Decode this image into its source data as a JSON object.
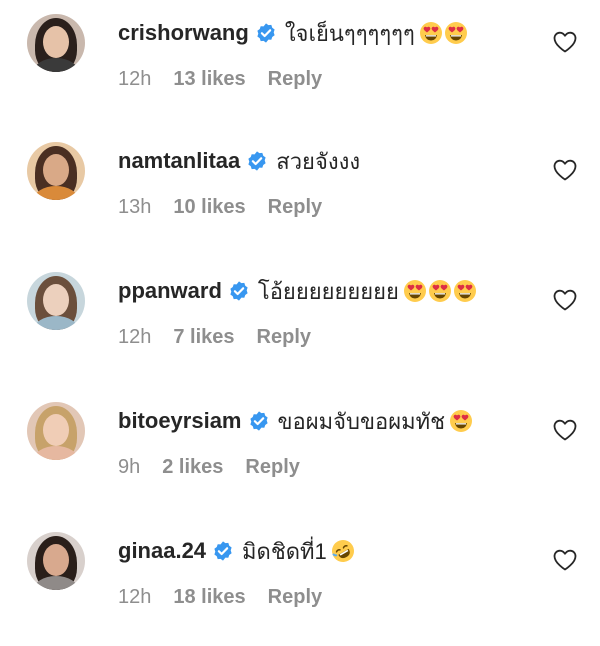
{
  "comments": [
    {
      "username": "crishorwang",
      "verified": true,
      "text": "ใจเย็นๆๆๆๆๆๆ",
      "emojis": [
        "heart-eyes",
        "heart-eyes"
      ],
      "time": "12h",
      "likes": "13 likes",
      "reply": "Reply",
      "avatar": {
        "bg": "#c9b8ad",
        "hair": "#2b201c",
        "skin": "#e6c2a8",
        "body": "#3a3a3a"
      }
    },
    {
      "username": "namtanlitaa",
      "verified": true,
      "text": "สวยจังงง",
      "emojis": [],
      "time": "13h",
      "likes": "10 likes",
      "reply": "Reply",
      "avatar": {
        "bg": "#e8c9a4",
        "hair": "#4a2f22",
        "skin": "#d9a987",
        "body": "#d98a3a"
      }
    },
    {
      "username": "ppanward",
      "verified": true,
      "text": "โอ้ยยยยยยยยย",
      "emojis": [
        "heart-eyes",
        "heart-eyes",
        "heart-eyes"
      ],
      "time": "12h",
      "likes": "7 likes",
      "reply": "Reply",
      "avatar": {
        "bg": "#c7d6dc",
        "hair": "#6b4f3c",
        "skin": "#ecd0bd",
        "body": "#9bb7c7"
      }
    },
    {
      "username": "bitoeyrsiam",
      "verified": true,
      "text": "ขอผมจับขอผมทัช",
      "emojis": [
        "heart-eyes"
      ],
      "time": "9h",
      "likes": "2 likes",
      "reply": "Reply",
      "avatar": {
        "bg": "#e2c7b6",
        "hair": "#c7a26a",
        "skin": "#f0cdb6",
        "body": "#e6b8a0"
      }
    },
    {
      "username": "ginaa.24",
      "verified": true,
      "text": "มิดชิดที่1",
      "emojis": [
        "rofl"
      ],
      "time": "12h",
      "likes": "18 likes",
      "reply": "Reply",
      "avatar": {
        "bg": "#d8d0cc",
        "hair": "#2a1f1a",
        "skin": "#d8a98e",
        "body": "#8f8a88"
      }
    }
  ]
}
